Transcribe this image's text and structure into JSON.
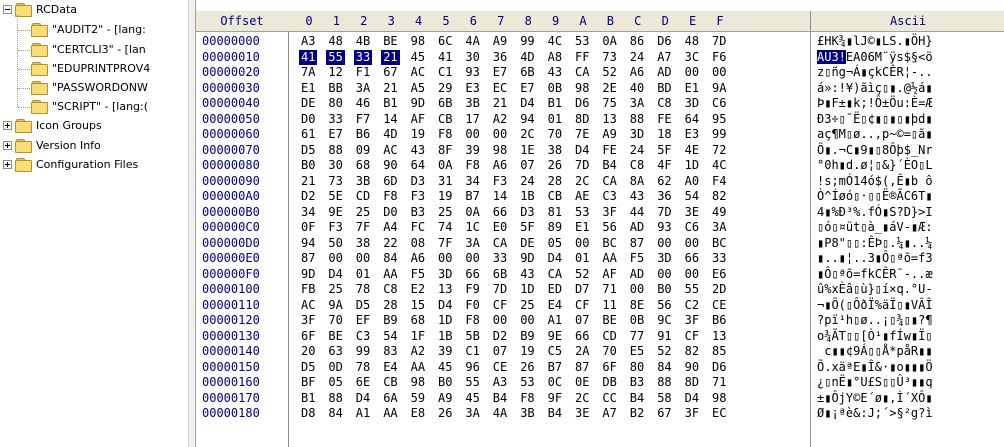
{
  "tree": {
    "items": [
      {
        "label": "RCData",
        "expander": "minus",
        "level": 0
      },
      {
        "label": "\"AUDIT2\" - [lang:",
        "level": 1
      },
      {
        "label": "\"CERTCLI3\" - [lan",
        "level": 1
      },
      {
        "label": "\"EDUPRINTPROV4",
        "level": 1
      },
      {
        "label": "\"PASSWORDONW",
        "level": 1
      },
      {
        "label": "\"SCRIPT\" - [lang:(",
        "level": 1,
        "selected": true
      },
      {
        "label": "Icon Groups",
        "expander": "plus",
        "level": 0
      },
      {
        "label": "Version Info",
        "expander": "plus",
        "level": 0
      },
      {
        "label": "Configuration Files",
        "expander": "plus",
        "level": 0
      }
    ]
  },
  "hex": {
    "columns": [
      "Offset",
      "0",
      "1",
      "2",
      "3",
      "4",
      "5",
      "6",
      "7",
      "8",
      "9",
      "A",
      "B",
      "C",
      "D",
      "E",
      "F",
      "Ascii"
    ],
    "selection": {
      "row": 1,
      "start": 0,
      "end": 4,
      "ascii_chars": 4
    },
    "rows": [
      {
        "offset": "00000000",
        "bytes": [
          "A3",
          "48",
          "4B",
          "BE",
          "98",
          "6C",
          "4A",
          "A9",
          "99",
          "4C",
          "53",
          "0A",
          "86",
          "D6",
          "48",
          "7D"
        ],
        "ascii": "£HK¾▮lJ©▮LS.▮ÖH}"
      },
      {
        "offset": "00000010",
        "bytes": [
          "41",
          "55",
          "33",
          "21",
          "45",
          "41",
          "30",
          "36",
          "4D",
          "A8",
          "FF",
          "73",
          "24",
          "A7",
          "3C",
          "F6"
        ],
        "ascii": "AU3!EA06M¨ÿs$§<ö"
      },
      {
        "offset": "00000020",
        "bytes": [
          "7A",
          "12",
          "F1",
          "67",
          "AC",
          "C1",
          "93",
          "E7",
          "6B",
          "43",
          "CA",
          "52",
          "A6",
          "AD",
          "00",
          "00"
        ],
        "ascii": "z▯ñg¬Á▮çkCÊR¦-.."
      },
      {
        "offset": "00000030",
        "bytes": [
          "E1",
          "BB",
          "3A",
          "21",
          "A5",
          "29",
          "E3",
          "EC",
          "E7",
          "0B",
          "98",
          "2E",
          "40",
          "BD",
          "E1",
          "9A"
        ],
        "ascii": "á»:!¥)ãìç▯▮.@½á▮"
      },
      {
        "offset": "00000040",
        "bytes": [
          "DE",
          "80",
          "46",
          "B1",
          "9D",
          "6B",
          "3B",
          "21",
          "D4",
          "B1",
          "D6",
          "75",
          "3A",
          "C8",
          "3D",
          "C6"
        ],
        "ascii": "Þ▮F±▮k;!Ô±Öu:È=Æ"
      },
      {
        "offset": "00000050",
        "bytes": [
          "D0",
          "33",
          "F7",
          "14",
          "AF",
          "CB",
          "17",
          "A2",
          "94",
          "01",
          "8D",
          "13",
          "88",
          "FE",
          "64",
          "95"
        ],
        "ascii": "Ð3÷▯¯Ë▯¢▮▯▮▯▮þd▮"
      },
      {
        "offset": "00000060",
        "bytes": [
          "61",
          "E7",
          "B6",
          "4D",
          "19",
          "F8",
          "00",
          "00",
          "2C",
          "70",
          "7E",
          "A9",
          "3D",
          "18",
          "E3",
          "99"
        ],
        "ascii": "aç¶M▯ø..,p~©=▯ã▮"
      },
      {
        "offset": "00000070",
        "bytes": [
          "D5",
          "88",
          "09",
          "AC",
          "43",
          "8F",
          "39",
          "98",
          "1E",
          "38",
          "D4",
          "FE",
          "24",
          "5F",
          "4E",
          "72"
        ],
        "ascii": "Õ▮.¬C▮9▮▯8Ôþ$_Nr"
      },
      {
        "offset": "00000080",
        "bytes": [
          "B0",
          "30",
          "68",
          "90",
          "64",
          "0A",
          "F8",
          "A6",
          "07",
          "26",
          "7D",
          "B4",
          "C8",
          "4F",
          "1D",
          "4C"
        ],
        "ascii": "°0h▮d.ø¦▯&}´ÈO▯L"
      },
      {
        "offset": "00000090",
        "bytes": [
          "21",
          "73",
          "3B",
          "6D",
          "D3",
          "31",
          "34",
          "F3",
          "24",
          "28",
          "2C",
          "CA",
          "8A",
          "62",
          "A0",
          "F4"
        ],
        "ascii": "!s;mÓ14ó$(,Ê▮b ô"
      },
      {
        "offset": "000000A0",
        "bytes": [
          "D2",
          "5E",
          "CD",
          "F8",
          "F3",
          "19",
          "B7",
          "14",
          "1B",
          "CB",
          "AE",
          "C3",
          "43",
          "36",
          "54",
          "82"
        ],
        "ascii": "Ò^Íøó▯·▯▯Ë®ÃC6T▮"
      },
      {
        "offset": "000000B0",
        "bytes": [
          "34",
          "9E",
          "25",
          "D0",
          "B3",
          "25",
          "0A",
          "66",
          "D3",
          "81",
          "53",
          "3F",
          "44",
          "7D",
          "3E",
          "49"
        ],
        "ascii": "4▮%Ð³%.fÓ▮S?D}>I"
      },
      {
        "offset": "000000C0",
        "bytes": [
          "0F",
          "F3",
          "7F",
          "A4",
          "FC",
          "74",
          "1C",
          "E0",
          "5F",
          "89",
          "E1",
          "56",
          "AD",
          "93",
          "C6",
          "3A"
        ],
        "ascii": "▯ó▯¤üt▯à_▮áV-▮Æ:"
      },
      {
        "offset": "000000D0",
        "bytes": [
          "94",
          "50",
          "38",
          "22",
          "08",
          "7F",
          "3A",
          "CA",
          "DE",
          "05",
          "00",
          "BC",
          "87",
          "00",
          "00",
          "BC"
        ],
        "ascii": "▮P8\"▯▯:ÊÞ▯.¼▮..¼"
      },
      {
        "offset": "000000E0",
        "bytes": [
          "87",
          "00",
          "00",
          "84",
          "A6",
          "00",
          "00",
          "33",
          "9D",
          "D4",
          "01",
          "AA",
          "F5",
          "3D",
          "66",
          "33"
        ],
        "ascii": "▮..▮¦..3▮Ô▯ªõ=f3"
      },
      {
        "offset": "000000F0",
        "bytes": [
          "9D",
          "D4",
          "01",
          "AA",
          "F5",
          "3D",
          "66",
          "6B",
          "43",
          "CA",
          "52",
          "AF",
          "AD",
          "00",
          "00",
          "E6"
        ],
        "ascii": "▮Ô▯ªõ=fkCÊR¯-..æ"
      },
      {
        "offset": "00000100",
        "bytes": [
          "FB",
          "25",
          "78",
          "C8",
          "E2",
          "13",
          "F9",
          "7D",
          "1D",
          "ED",
          "D7",
          "71",
          "00",
          "B0",
          "55",
          "2D"
        ],
        "ascii": "û%xÈâ▯ù}▯í×q.°U-"
      },
      {
        "offset": "00000110",
        "bytes": [
          "AC",
          "9A",
          "D5",
          "28",
          "15",
          "D4",
          "F0",
          "CF",
          "25",
          "E4",
          "CF",
          "11",
          "8E",
          "56",
          "C2",
          "CE"
        ],
        "ascii": "¬▮Õ(▯ÔðÏ%äÏ▯▮VÂÎ"
      },
      {
        "offset": "00000120",
        "bytes": [
          "3F",
          "70",
          "EF",
          "B9",
          "68",
          "1D",
          "F8",
          "00",
          "00",
          "A1",
          "07",
          "BE",
          "0B",
          "9C",
          "3F",
          "B6"
        ],
        "ascii": "?pï¹h▯ø..¡▯¾▯▮?¶"
      },
      {
        "offset": "00000130",
        "bytes": [
          "6F",
          "BE",
          "C3",
          "54",
          "1F",
          "1B",
          "5B",
          "D2",
          "B9",
          "9E",
          "66",
          "CD",
          "77",
          "91",
          "CF",
          "13"
        ],
        "ascii": "o¾ÃT▯▯[Ò¹▮fÍw▮Ï▯"
      },
      {
        "offset": "00000140",
        "bytes": [
          "20",
          "63",
          "99",
          "83",
          "A2",
          "39",
          "C1",
          "07",
          "19",
          "C5",
          "2A",
          "70",
          "E5",
          "52",
          "82",
          "85"
        ],
        "ascii": " c▮▮¢9Á▯▯Å*påR▮▮"
      },
      {
        "offset": "00000150",
        "bytes": [
          "D5",
          "0D",
          "78",
          "E4",
          "AA",
          "45",
          "96",
          "CE",
          "26",
          "B7",
          "87",
          "6F",
          "80",
          "84",
          "90",
          "D6"
        ],
        "ascii": "Õ.xäªE▮Î&·▮o▮▮▮Ö"
      },
      {
        "offset": "00000160",
        "bytes": [
          "BF",
          "05",
          "6E",
          "CB",
          "98",
          "B0",
          "55",
          "A3",
          "53",
          "0C",
          "0E",
          "DB",
          "B3",
          "88",
          "8D",
          "71"
        ],
        "ascii": "¿▯nË▮°U£S▯▯Û³▮▮q"
      },
      {
        "offset": "00000170",
        "bytes": [
          "B1",
          "88",
          "D4",
          "6A",
          "59",
          "A9",
          "45",
          "B4",
          "F8",
          "9F",
          "2C",
          "CC",
          "B4",
          "58",
          "D4",
          "98"
        ],
        "ascii": "±▮ÔjY©E´ø▮,Ì´XÔ▮"
      },
      {
        "offset": "00000180",
        "bytes": [
          "D8",
          "84",
          "A1",
          "AA",
          "E8",
          "26",
          "3A",
          "4A",
          "3B",
          "B4",
          "3E",
          "A7",
          "B2",
          "67",
          "3F",
          "EC"
        ],
        "ascii": "Ø▮¡ªè&:J;´>§²g?ì"
      }
    ]
  }
}
